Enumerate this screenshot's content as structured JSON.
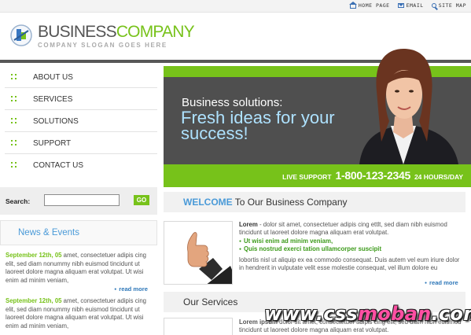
{
  "top_links": [
    {
      "label": "HOME PAGE",
      "icon": "home-icon"
    },
    {
      "label": "EMAIL",
      "icon": "mail-icon"
    },
    {
      "label": "SITE MAP",
      "icon": "search-icon"
    }
  ],
  "logo": {
    "name_part1": "BUSINESS",
    "name_part2": "COMPANY",
    "slogan": "COMPANY SLOGAN GOES HERE"
  },
  "nav": [
    {
      "label": "ABOUT US"
    },
    {
      "label": "SERVICES"
    },
    {
      "label": "SOLUTIONS"
    },
    {
      "label": "SUPPORT"
    },
    {
      "label": "CONTACT US"
    }
  ],
  "search": {
    "label": "Search:",
    "value": "",
    "placeholder": "",
    "button": "GO"
  },
  "news": {
    "title": "News & Events",
    "items": [
      {
        "date": "September 12th, 05",
        "text": " amet, consectetuer adipis cing elit, sed diam nonummy nibh euismod tincidunt ut laoreet dolore magna aliquam erat volutpat. Ut wisi enim ad minim veniam,",
        "more": "read more"
      },
      {
        "date": "September 12th, 05",
        "text": " amet, consectetuer adipis cing elit, sed diam nonummy nibh euismod tincidunt ut laoreet dolore magna aliquam erat volutpat. Ut wisi enim ad minim veniam,",
        "more": ""
      }
    ]
  },
  "banner": {
    "line1": "Business solutions:",
    "line2": "Fresh ideas for your success!",
    "support_label": "LIVE SUPPORT",
    "phone": "1-800-123-2345",
    "hours": "24 HOURS/DAY",
    "colors": {
      "green": "#77c21a",
      "dark": "#4f4f4f",
      "light_blue": "#aee2ff"
    }
  },
  "welcome": {
    "title_highlight": "WELCOME",
    "title_rest": " To Our Business Company",
    "lead_bold": "Lorem",
    "lead_text": " - dolor sit amet, consectetuer adipis cing ettlt, sed diam nibh euismod tincidunt ut laoreet dolore magna aliquam erat volutpat.",
    "bullets": [
      "Ut wisi enim ad minim veniam,",
      "Quis nostrud exerci tation ullamcorper suscipit"
    ],
    "para2": "lobortis nisl ut aliquip ex ea commodo consequat. Duis autem vel eum iriure dolor in hendrerit in vulputate velit esse molestie consequat, vel illum dolore eu",
    "more": "read more"
  },
  "services": {
    "title": "Our Services",
    "lead_bold": "Lorem ipsum",
    "lead_text": " dolor sit amet, consectetuer adipis cing elit, sed diam nibh euismod tincidunt ut laoreet dolore magna aliquam erat volutpat."
  },
  "watermark": {
    "left": "www.css",
    "mid": "moban",
    "right": ".com"
  }
}
